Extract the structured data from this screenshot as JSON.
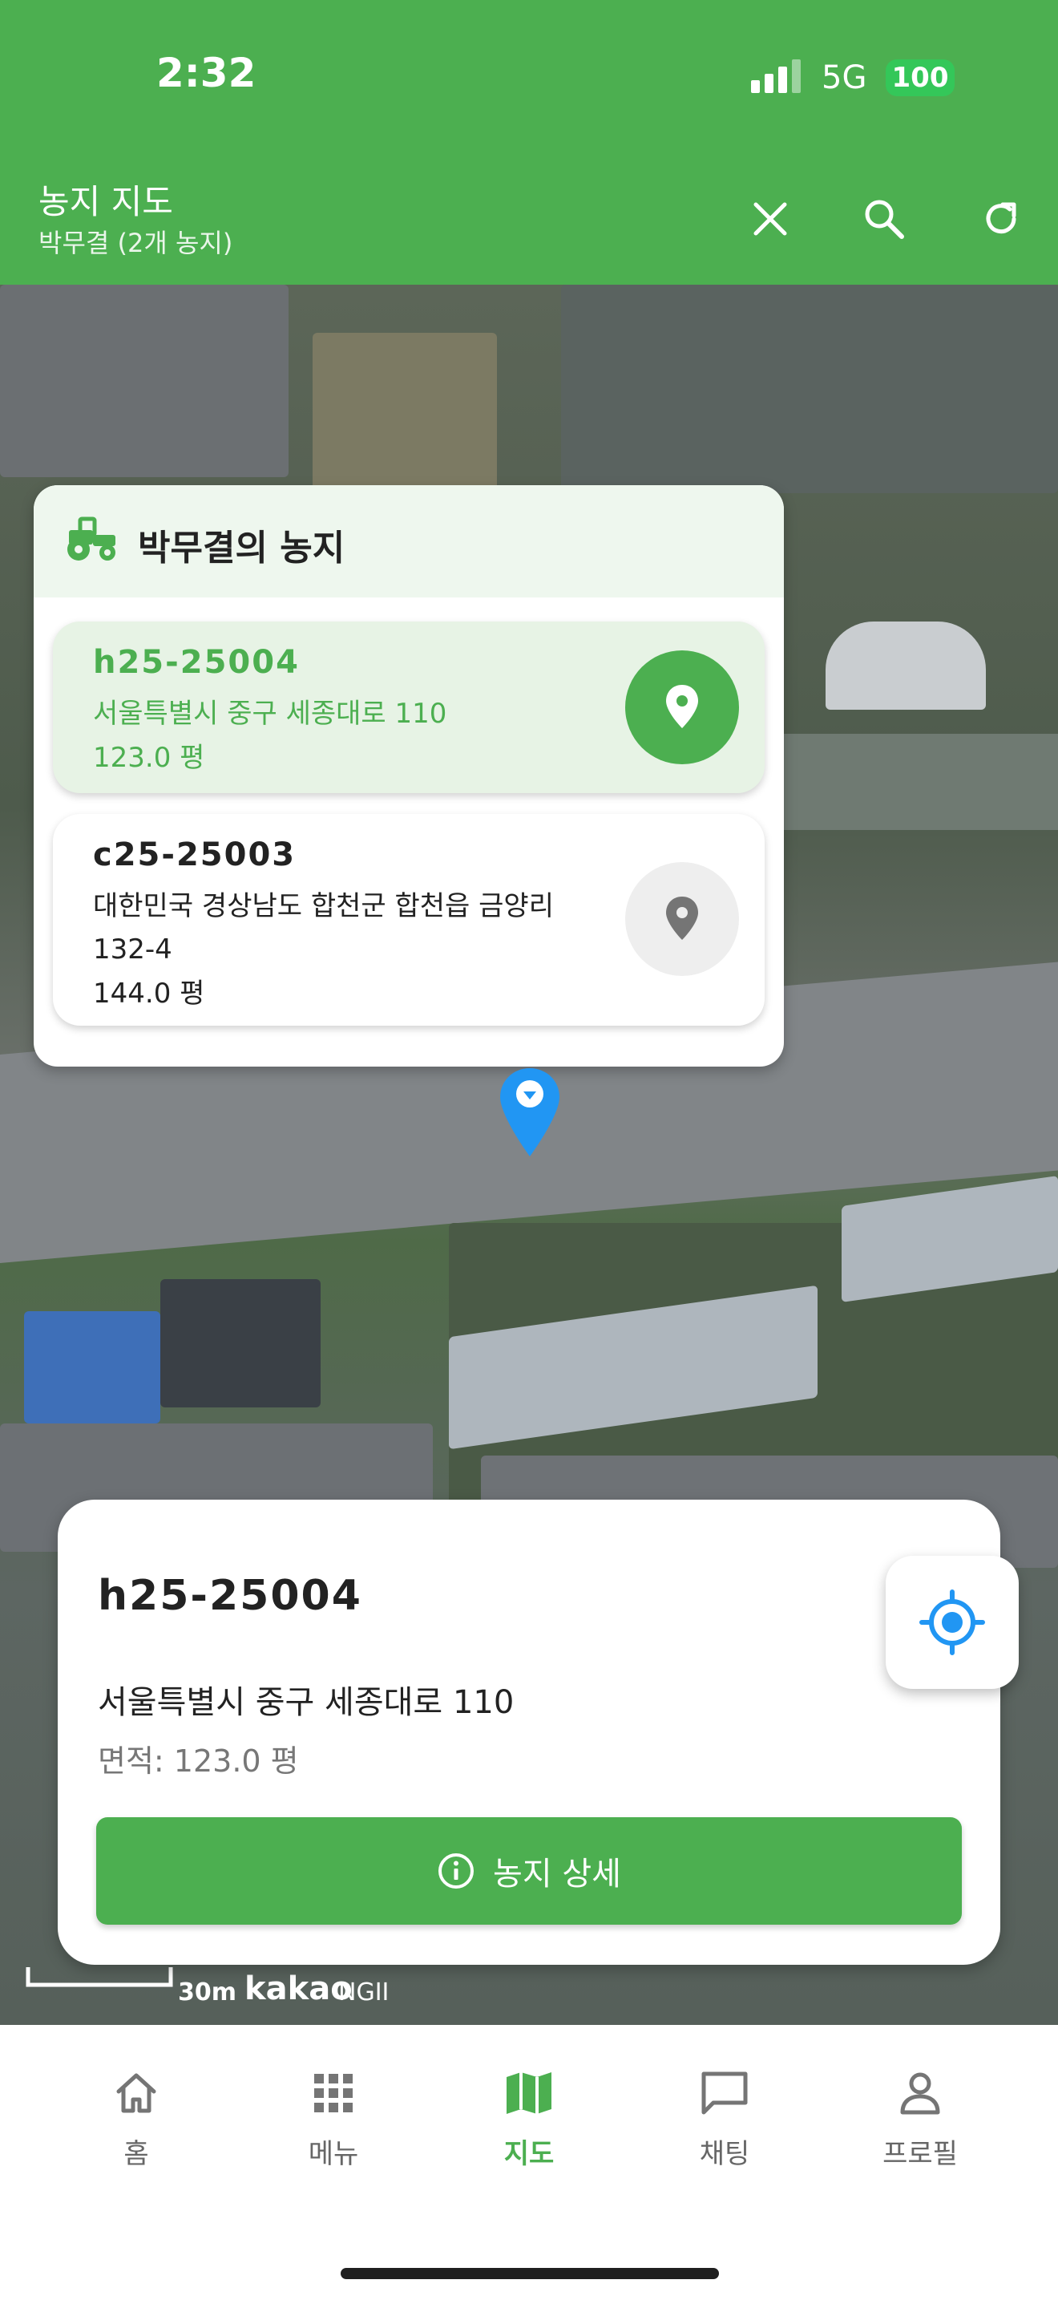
{
  "status_bar": {
    "time": "2:32",
    "network": "5G",
    "battery": "100"
  },
  "appbar": {
    "title": "농지 지도",
    "subtitle": "박무결 (2개 농지)"
  },
  "farm_panel": {
    "title": "박무결의 농지",
    "items": [
      {
        "id": "h25-25004",
        "address": "서울특별시 중구 세종대로 110",
        "area": "123.0 평",
        "selected": true
      },
      {
        "id": "c25-25003",
        "address": "대한민국 경상남도 합천군 합천읍 금양리 132-4",
        "area": "144.0 평",
        "selected": false
      }
    ]
  },
  "detail_card": {
    "id": "h25-25004",
    "address": "서울특별시 중구 세종대로 110",
    "area": "면적: 123.0 평",
    "button_label": "농지 상세"
  },
  "map_attribution": {
    "scale": "30m",
    "provider": "kakao",
    "source": "NGII"
  },
  "bottom_nav": [
    {
      "label": "홈",
      "icon": "home-icon",
      "active": false
    },
    {
      "label": "메뉴",
      "icon": "grid-icon",
      "active": false
    },
    {
      "label": "지도",
      "icon": "map-icon",
      "active": true
    },
    {
      "label": "채팅",
      "icon": "chat-icon",
      "active": false
    },
    {
      "label": "프로필",
      "icon": "person-icon",
      "active": false
    }
  ],
  "colors": {
    "primary": "#4caf50",
    "selected_card": "#e7f3e5",
    "marker": "#2196f3"
  }
}
